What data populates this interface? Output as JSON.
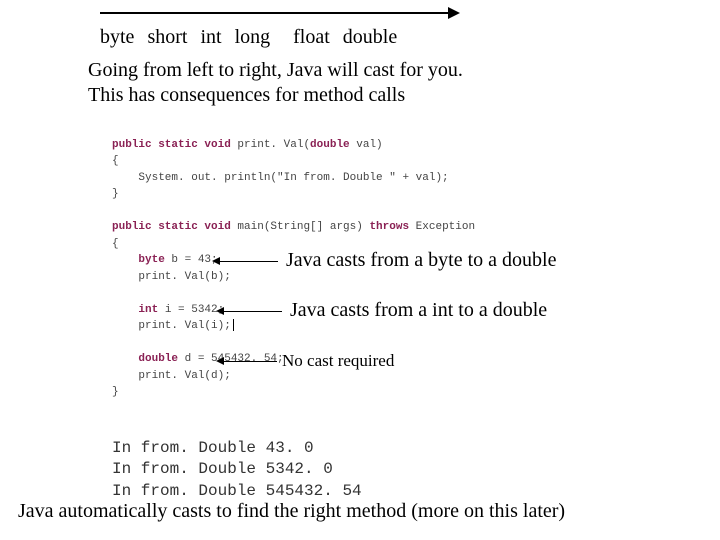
{
  "types": [
    "byte",
    "short",
    "int",
    "long",
    "float",
    "double"
  ],
  "explain_line1": "Going from left to right, Java will cast for you.",
  "explain_line2": "This has consequences for method calls",
  "code": {
    "l1a": "public static void",
    "l1b": " print. Val(",
    "l1c": "double",
    "l1d": " val)",
    "l2": "{",
    "l3": "    System. out. println(\"In from. Double \" + val);",
    "l4": "}",
    "l5a": "public static void",
    "l5b": " main(String[] args) ",
    "l5c": "throws",
    "l5d": " Exception",
    "l6": "{",
    "l7a": "    byte",
    "l7b": " b = 43;",
    "l8": "    print. Val(b);",
    "l9a": "    int",
    "l9b": " i = 5342;",
    "l10": "    print. Val(i);",
    "l11a": "    double",
    "l11b": " d = 545432. 54;",
    "l12": "    print. Val(d);",
    "l13": "}"
  },
  "annot1": "Java casts from a byte to a double",
  "annot2": "Java casts from a int to a double",
  "annot3": "No cast required",
  "output": {
    "o1": "In from. Double 43. 0",
    "o2": "In from. Double 5342. 0",
    "o3": "In from. Double 545432. 54"
  },
  "bottom": "Java automatically casts to find the right method (more on this later)"
}
